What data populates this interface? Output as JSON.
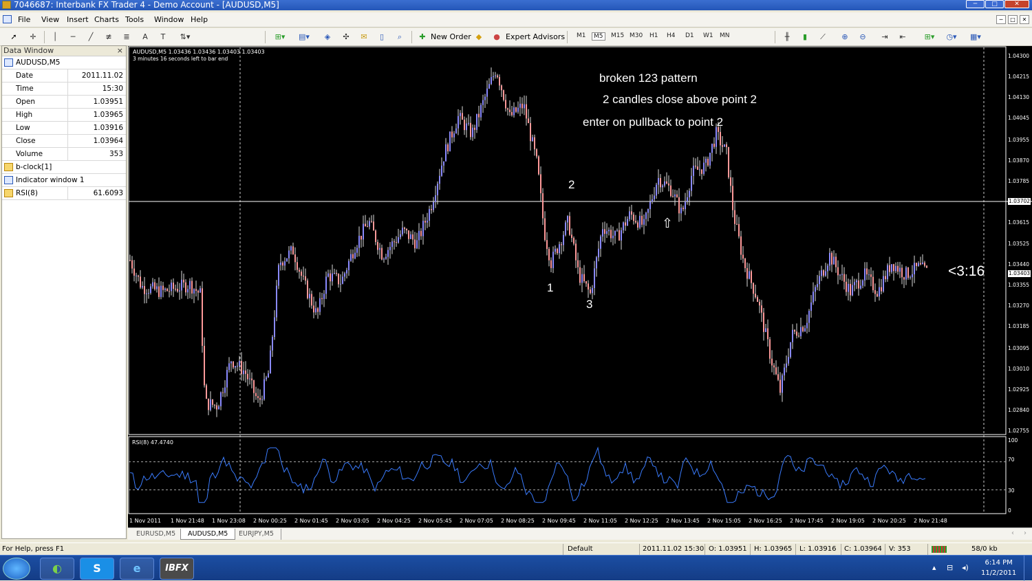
{
  "window": {
    "title": "7046687: Interbank FX Trader 4 - Demo Account - [AUDUSD,M5]",
    "min": "─",
    "max": "□",
    "close": "✕"
  },
  "menu": [
    "File",
    "View",
    "Insert",
    "Charts",
    "Tools",
    "Window",
    "Help"
  ],
  "toolbar": {
    "new_order": "New Order",
    "expert_advisors": "Expert Advisors",
    "timeframes": [
      "M1",
      "M5",
      "M15",
      "M30",
      "H1",
      "H4",
      "D1",
      "W1",
      "MN"
    ],
    "active_timeframe": "M5"
  },
  "data_window": {
    "title": "Data Window",
    "close": "×",
    "symbol": "AUDUSD,M5",
    "rows": [
      {
        "label": "Date",
        "value": "2011.11.02"
      },
      {
        "label": "Time",
        "value": "15:30"
      },
      {
        "label": "Open",
        "value": "1.03951"
      },
      {
        "label": "High",
        "value": "1.03965"
      },
      {
        "label": "Low",
        "value": "1.03916"
      },
      {
        "label": "Close",
        "value": "1.03964"
      },
      {
        "label": "Volume",
        "value": "353"
      }
    ],
    "bclock": "b-clock[1]",
    "indicator_window": "Indicator window 1",
    "rsi_label": "RSI(8)",
    "rsi_value": "61.6093"
  },
  "chart": {
    "symbol_line": "AUDUSD,M5  1.03436 1.03436 1.03403 1.03403",
    "timer_line": "3 minutes 16 seconds left to bar end",
    "price_labels": [
      "1.04300",
      "1.04215",
      "1.04130",
      "1.04045",
      "1.03955",
      "1.03870",
      "1.03785",
      "1.03702",
      "1.03615",
      "1.03525",
      "1.03440",
      "1.03403",
      "1.03355",
      "1.03270",
      "1.03185",
      "1.03095",
      "1.03010",
      "1.02925",
      "1.02840",
      "1.02755"
    ],
    "hline_price": "1.03702",
    "current_price": "1.03403",
    "annotations": {
      "line1": "broken 123 pattern",
      "line2": "2 candles close above point 2",
      "line3": "enter on pullback to point 2",
      "p1": "1",
      "p2": "2",
      "p3": "3",
      "arrow": "⇧",
      "countdown": "<3:16"
    },
    "time_labels": [
      "1 Nov 2011",
      "1 Nov 21:48",
      "1 Nov 23:08",
      "2 Nov 00:25",
      "2 Nov 01:45",
      "2 Nov 03:05",
      "2 Nov 04:25",
      "2 Nov 05:45",
      "2 Nov 07:05",
      "2 Nov 08:25",
      "2 Nov 09:45",
      "2 Nov 11:05",
      "2 Nov 12:25",
      "2 Nov 13:45",
      "2 Nov 15:05",
      "2 Nov 16:25",
      "2 Nov 17:45",
      "2 Nov 19:05",
      "2 Nov 20:25",
      "2 Nov 21:48"
    ],
    "indicator": {
      "label": "RSI(8) 47.4740",
      "levels": [
        "100",
        "70",
        "30",
        "0"
      ]
    },
    "colors": {
      "bull": "#8a8aff",
      "bear": "#ff9a9a",
      "rsi": "#3a7cff",
      "bg": "#000000"
    }
  },
  "tabs": [
    "EURUSD,M5",
    "AUDUSD,M5",
    "EURJPY,M5"
  ],
  "active_tab": "AUDUSD,M5",
  "status": {
    "help": "For Help, press F1",
    "profile": "Default",
    "datetime": "2011.11.02 15:30",
    "open": "O: 1.03951",
    "high": "H: 1.03965",
    "low": "L: 1.03916",
    "close": "C: 1.03964",
    "volume": "V: 353",
    "traffic": "58/0 kb"
  },
  "taskbar": {
    "ibfx": "IBFX",
    "time": "6:14 PM",
    "date": "11/2/2011"
  }
}
